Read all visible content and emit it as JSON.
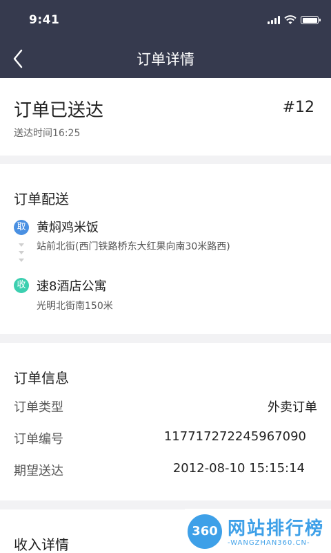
{
  "status_bar": {
    "time": "9:41"
  },
  "nav": {
    "title": "订单详情"
  },
  "order_status": {
    "title": "订单已送达",
    "number": "#12",
    "delivered_time": "送达时间16:25"
  },
  "delivery": {
    "title": "订单配送",
    "pickup": {
      "badge": "取",
      "name": "黄焖鸡米饭",
      "address": "站前北街(西门铁路桥东大红果向南30米路西)"
    },
    "receive": {
      "badge": "收",
      "name": "速8酒店公寓",
      "address": "光明北街南150米"
    }
  },
  "order_info": {
    "title": "订单信息",
    "rows": [
      {
        "label": "订单类型",
        "value": "外卖订单"
      },
      {
        "label": "订单编号",
        "value": "117717272245967090"
      },
      {
        "label": "期望送达",
        "value": "2012-08-10 15:15:14"
      }
    ]
  },
  "income": {
    "title": "收入详情"
  },
  "watermark": {
    "logo": "360",
    "text": "网站排行榜",
    "sub": "-WANGZHAN360.CN-"
  },
  "colors": {
    "header_bg": "#363a4e",
    "pickup_badge": "#4a90e2",
    "receive_badge": "#3ccfb0"
  }
}
